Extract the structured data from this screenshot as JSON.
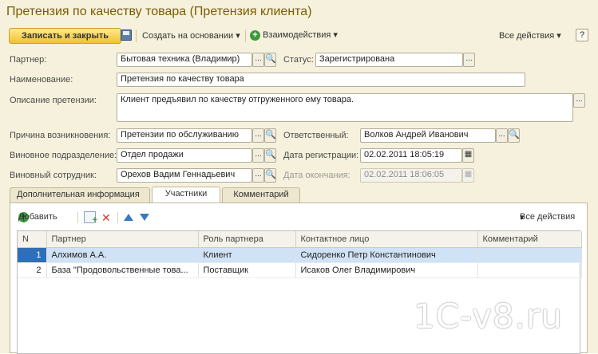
{
  "window": {
    "title": "Претензия по качеству товара (Претензия клиента)"
  },
  "toolbar": {
    "save_close": "Записать и закрыть",
    "create_based": "Создать на основании",
    "interactions": "Взаимодействия",
    "all_actions": "Все действия",
    "help": "?"
  },
  "form": {
    "partner_label": "Партнер:",
    "partner_value": "Бытовая техника (Владимир)",
    "status_label": "Статус:",
    "status_value": "Зарегистрирована",
    "name_label": "Наименование:",
    "name_value": "Претензия по качеству товара",
    "desc_label": "Описание претензии:",
    "desc_value": "Клиент предъявил по качеству отгруженного ему товара.",
    "reason_label": "Причина возникновения:",
    "reason_value": "Претензии по обслуживанию",
    "responsible_label": "Ответственный:",
    "responsible_value": "Волков Андрей Иванович",
    "dept_label": "Виновное подразделение:",
    "dept_value": "Отдел продажи",
    "reg_date_label": "Дата регистрации:",
    "reg_date_value": "02.02.2011 18:05:19",
    "employee_label": "Виновный сотрудник:",
    "employee_value": "Орехов Вадим Геннадьевич",
    "end_date_label": "Дата окончания:",
    "end_date_value": "02.02.2011 18:06:05",
    "dots": "...",
    "mag": "🔍"
  },
  "tabs": [
    {
      "label": "Дополнительная информация"
    },
    {
      "label": "Участники"
    },
    {
      "label": "Комментарий"
    }
  ],
  "participants": {
    "add_label": "Добавить",
    "all_actions": "Все действия",
    "columns": [
      "N",
      "Партнер",
      "Роль партнера",
      "Контактное лицо",
      "Комментарий"
    ],
    "rows": [
      [
        "1",
        "Алхимов А.А.",
        "Клиент",
        "Сидоренко Петр Константинович",
        ""
      ],
      [
        "2",
        "База \"Продовольственные това...",
        "Поставщик",
        "Исаков Олег Владимирович",
        ""
      ]
    ]
  },
  "watermark": "1C-v8.ru",
  "colors": {
    "form_bg": "#f6f1dc",
    "title": "#7a5c00",
    "primary_btn": "#f1c232",
    "selection": "#cfe2f6"
  }
}
